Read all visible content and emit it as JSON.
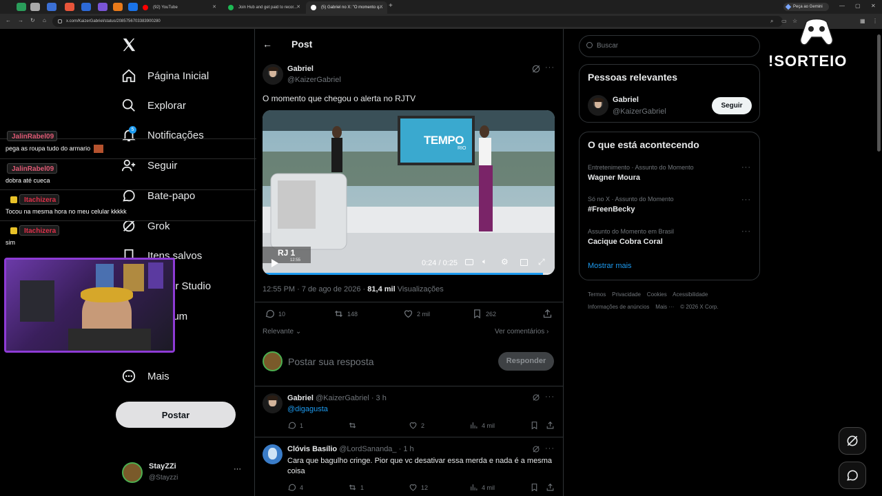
{
  "browser": {
    "tabs": [
      {
        "label": "(92) YouTube",
        "color": "#ff0000"
      },
      {
        "label": "Join Hub and get paid to recor...",
        "color": "#1db954"
      },
      {
        "label": "(5) Gabriel no X: \"O momento q...",
        "color": "#ffffff"
      }
    ],
    "new_tab": "+",
    "gemini_label": "Peça ao Gemini",
    "url": "x.com/KaizerGabriel/status/2085756703383900280"
  },
  "nav": {
    "items": [
      {
        "label": "Página Inicial",
        "icon": "home-icon"
      },
      {
        "label": "Explorar",
        "icon": "search-icon"
      },
      {
        "label": "Notificações",
        "icon": "bell-icon",
        "badge": "5"
      },
      {
        "label": "Seguir",
        "icon": "follow-icon"
      },
      {
        "label": "Bate-papo",
        "icon": "chat-icon"
      },
      {
        "label": "Grok",
        "icon": "grok-icon"
      },
      {
        "label": "Itens salvos",
        "icon": "bookmark-icon"
      },
      {
        "label": "or Studio",
        "icon": "studio-icon"
      },
      {
        "label": "ium",
        "icon": "premium-icon"
      },
      {
        "label": "Mais",
        "icon": "more-circle-icon"
      }
    ],
    "post_button": "Postar",
    "account": {
      "name": "StayZZi",
      "handle": "@Stayzzi",
      "more": "···"
    }
  },
  "post": {
    "header_title": "Post",
    "author_name": "Gabriel",
    "author_handle": "@KaizerGabriel",
    "text": "O momento que chegou o alerta no RJTV",
    "video": {
      "time": "0:24 / 0:25",
      "progress": 0.96,
      "tempo_text": "TEMPO",
      "tempo_sub": "RIO",
      "logo_text": "RJ 1",
      "logo_sub": "12:55"
    },
    "timestamp": "12:55 PM · 7 de ago de 2026 · ",
    "views_count": "81,4 mil",
    "views_label": " Visualizações",
    "stats": {
      "replies": "10",
      "reposts": "148",
      "likes": "2 mil",
      "bookmarks": "262"
    },
    "sort_label": "Relevante",
    "comments_link": "Ver comentários",
    "reply_placeholder": "Postar sua resposta",
    "reply_button": "Responder"
  },
  "replies": [
    {
      "name": "Gabriel",
      "handle": "@KaizerGabriel · 3 h",
      "text": "@digagusta",
      "replies": "1",
      "reposts": "",
      "likes": "2",
      "views": "4 mil"
    },
    {
      "name": "Clóvis Basílio",
      "handle": "@LordSananda_ · 1 h",
      "text": "Cara que bagulho cringe. Pior que vc desativar essa merda e nada é a mesma coisa",
      "replies": "4",
      "reposts": "1",
      "likes": "12",
      "views": "4 mil"
    }
  ],
  "right": {
    "search_placeholder": "Buscar",
    "relevant_title": "Pessoas relevantes",
    "relevant_person": {
      "name": "Gabriel",
      "handle": "@KaizerGabriel",
      "follow": "Seguir"
    },
    "happening_title": "O que está acontecendo",
    "trends": [
      {
        "meta": "Entretenimento · Assunto do Momento",
        "title": "Wagner Moura"
      },
      {
        "meta": "Só no X · Assunto do Momento",
        "title": "#FreenBecky"
      },
      {
        "meta": "Assunto do Momento em Brasil",
        "title": "Cacique Cobra Coral"
      }
    ],
    "show_more": "Mostrar mais",
    "footer_line1": "Termos    Privacidade    Cookies    Acessibilidade",
    "footer_line2": "Informações de anúncios    Mais ···    © 2026 X Corp."
  },
  "overlay": {
    "sorteio": "!SORTEIO",
    "chat": [
      {
        "name": "JalinRabel09",
        "message": "pega as roupa tudo do armario",
        "color": "#e05a75"
      },
      {
        "name": "JalinRabel09",
        "message": "dobra até cueca",
        "color": "#e05a75"
      },
      {
        "name": "Itachizera",
        "message": "Tocou na mesma hora no meu celular kkkkk",
        "color": "#e0304a"
      },
      {
        "name": "Itachizera",
        "message": "sim",
        "color": "#e0304a"
      }
    ]
  }
}
